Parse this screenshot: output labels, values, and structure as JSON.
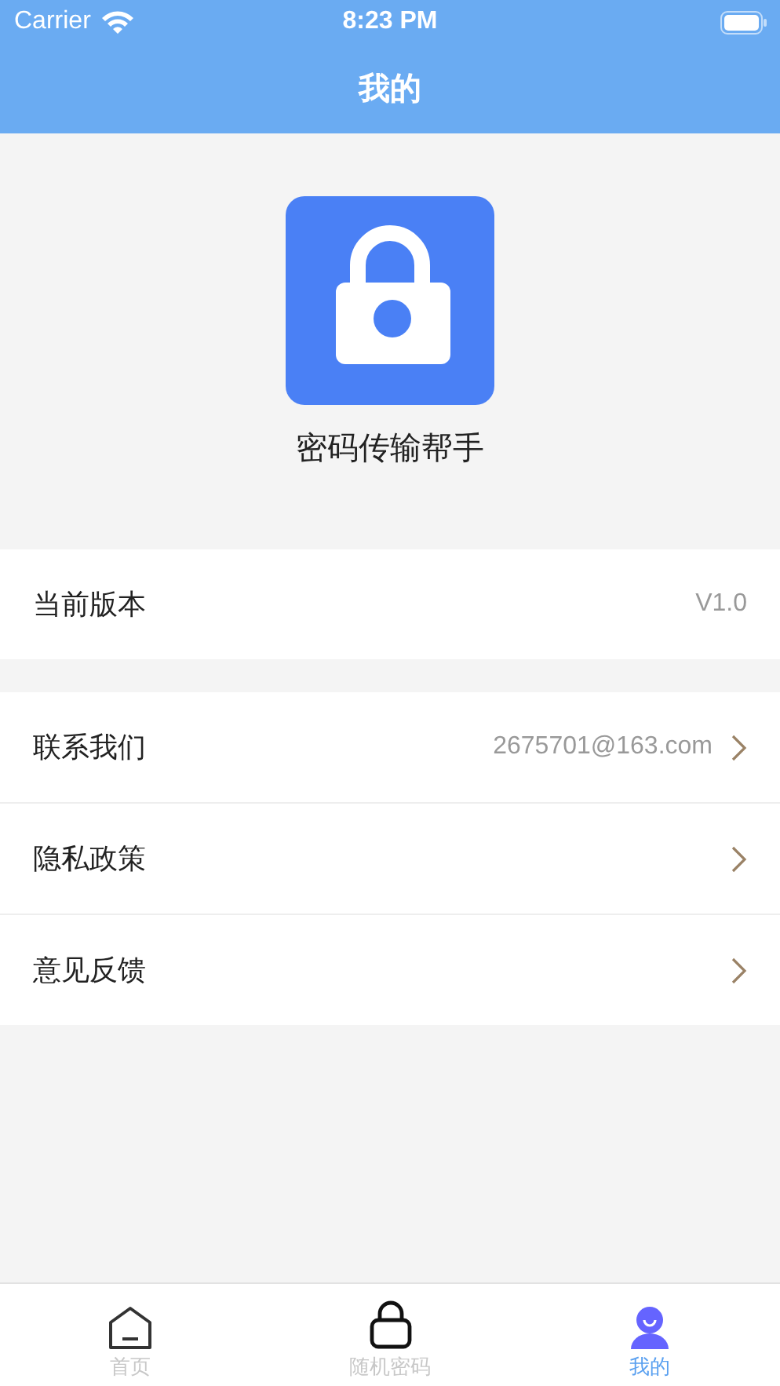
{
  "status_bar": {
    "carrier": "Carrier",
    "time": "8:23 PM"
  },
  "nav_bar": {
    "title": "我的"
  },
  "app": {
    "name": "密码传输帮手"
  },
  "groups": [
    {
      "rows": [
        {
          "label": "当前版本",
          "value": "V1.0",
          "chevron": false
        }
      ]
    },
    {
      "rows": [
        {
          "label": "联系我们",
          "value": "2675701@163.com",
          "chevron": true
        },
        {
          "label": "隐私政策",
          "chevron": true
        },
        {
          "label": "意见反馈",
          "chevron": true
        }
      ]
    }
  ],
  "tab_bar": [
    {
      "label": "首页",
      "kind": "home",
      "selected": false
    },
    {
      "label": "随机密码",
      "kind": "lock",
      "selected": false
    },
    {
      "label": "我的",
      "kind": "person",
      "selected": true
    }
  ]
}
